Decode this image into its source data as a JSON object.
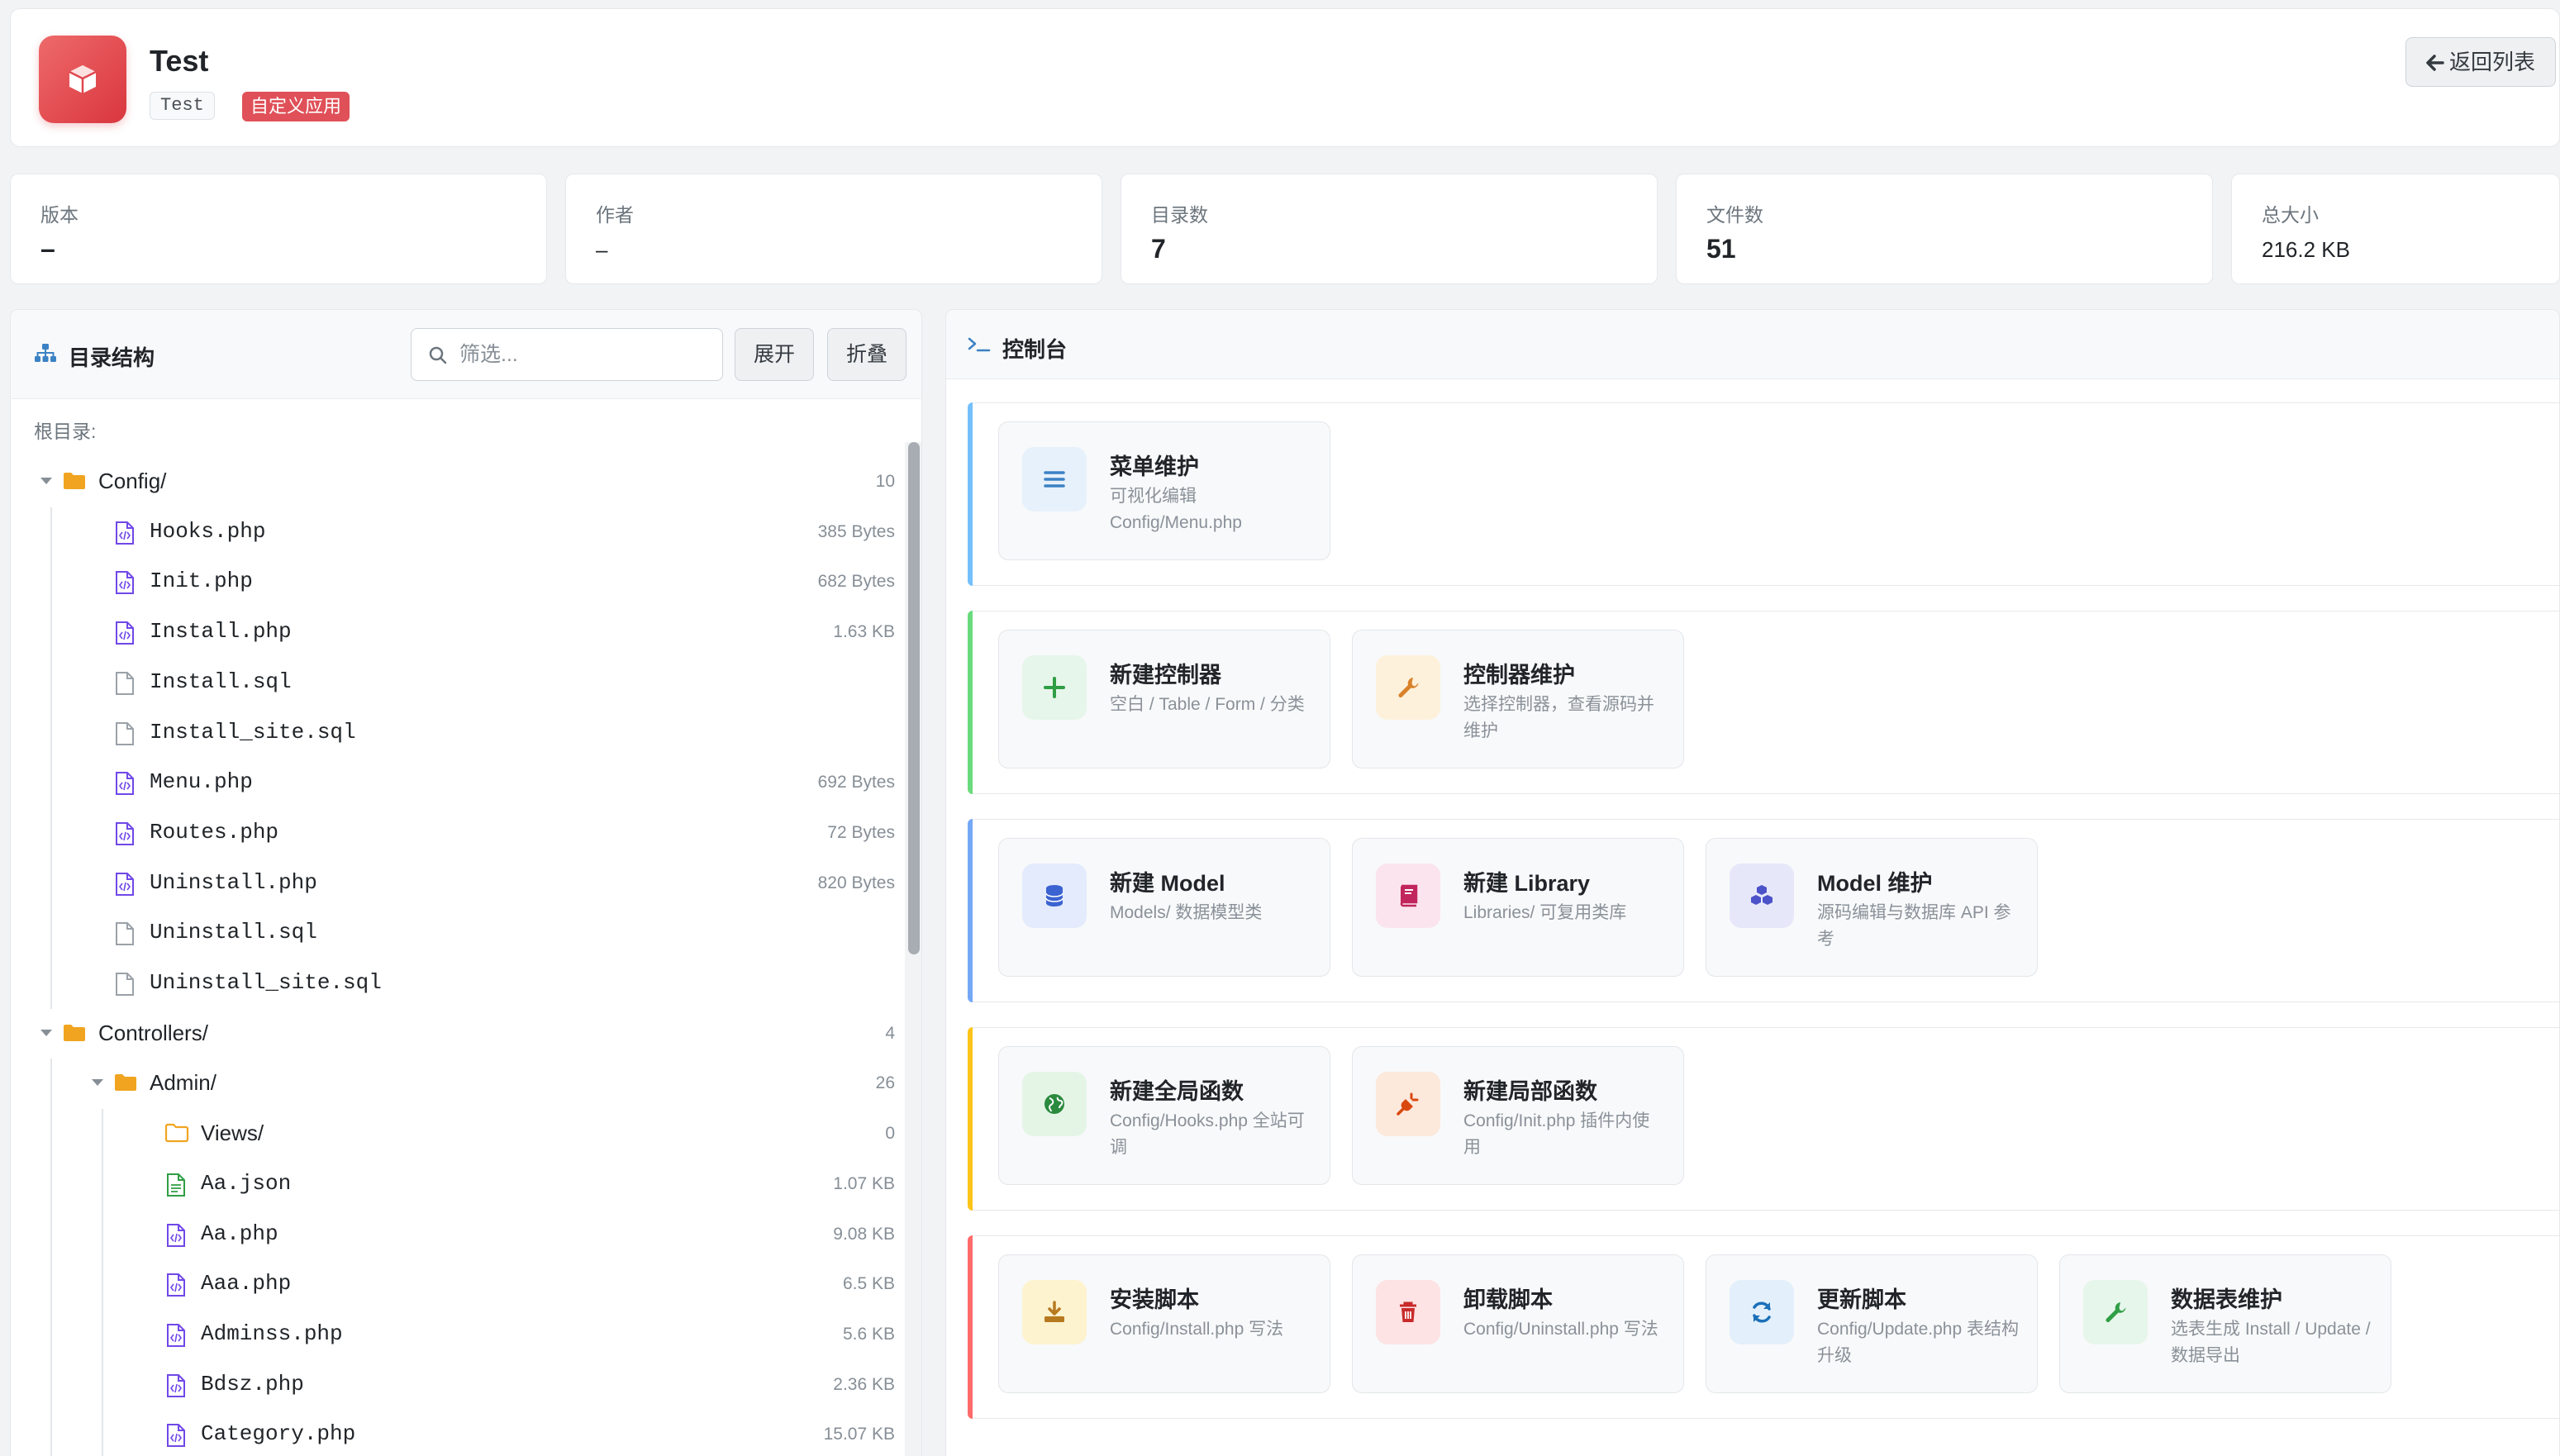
{
  "app": {
    "title": "Test",
    "code_tag": "Test",
    "type_tag": "自定义应用",
    "back_label": "返回列表",
    "icon": "cube-icon"
  },
  "stats": [
    {
      "label": "版本",
      "value": "–"
    },
    {
      "label": "作者",
      "value": "–"
    },
    {
      "label": "目录数",
      "value": "7"
    },
    {
      "label": "文件数",
      "value": "51"
    },
    {
      "label": "总大小",
      "value": "216.2 KB"
    }
  ],
  "directory": {
    "title": "目录结构",
    "filter_placeholder": "筛选...",
    "expand_label": "展开",
    "collapse_label": "折叠",
    "root_label": "根目录:",
    "rows": [
      {
        "name": "Config/",
        "meta": "10",
        "kind": "folder",
        "depth": 0,
        "open": true
      },
      {
        "name": "Hooks.php",
        "meta": "385 Bytes",
        "kind": "php",
        "depth": 1
      },
      {
        "name": "Init.php",
        "meta": "682 Bytes",
        "kind": "php",
        "depth": 1
      },
      {
        "name": "Install.php",
        "meta": "1.63 KB",
        "kind": "php",
        "depth": 1
      },
      {
        "name": "Install.sql",
        "meta": "",
        "kind": "file",
        "depth": 1
      },
      {
        "name": "Install_site.sql",
        "meta": "",
        "kind": "file",
        "depth": 1
      },
      {
        "name": "Menu.php",
        "meta": "692 Bytes",
        "kind": "php",
        "depth": 1
      },
      {
        "name": "Routes.php",
        "meta": "72 Bytes",
        "kind": "php",
        "depth": 1
      },
      {
        "name": "Uninstall.php",
        "meta": "820 Bytes",
        "kind": "php",
        "depth": 1
      },
      {
        "name": "Uninstall.sql",
        "meta": "",
        "kind": "file",
        "depth": 1
      },
      {
        "name": "Uninstall_site.sql",
        "meta": "",
        "kind": "file",
        "depth": 1
      },
      {
        "name": "Controllers/",
        "meta": "4",
        "kind": "folder",
        "depth": 0,
        "open": true
      },
      {
        "name": "Admin/",
        "meta": "26",
        "kind": "folder",
        "depth": 1,
        "open": true
      },
      {
        "name": "Views/",
        "meta": "0",
        "kind": "folder-empty",
        "depth": 2
      },
      {
        "name": "Aa.json",
        "meta": "1.07 KB",
        "kind": "json",
        "depth": 2
      },
      {
        "name": "Aa.php",
        "meta": "9.08 KB",
        "kind": "php",
        "depth": 2
      },
      {
        "name": "Aaa.php",
        "meta": "6.5 KB",
        "kind": "php",
        "depth": 2
      },
      {
        "name": "Adminss.php",
        "meta": "5.6 KB",
        "kind": "php",
        "depth": 2
      },
      {
        "name": "Bdsz.php",
        "meta": "2.36 KB",
        "kind": "php",
        "depth": 2
      },
      {
        "name": "Category.php",
        "meta": "15.07 KB",
        "kind": "php",
        "depth": 2
      }
    ]
  },
  "console": {
    "title": "控制台",
    "groups": [
      {
        "accent": "#74c0fc",
        "tiles": [
          {
            "title": "菜单维护",
            "desc": "可视化编辑 Config/Menu.php",
            "icon": "list-icon",
            "bg": "#e7f1fb",
            "fg": "#3b82c4"
          }
        ]
      },
      {
        "accent": "#69db7c",
        "tiles": [
          {
            "title": "新建控制器",
            "desc": "空白 / Table / Form / 分类",
            "icon": "plus-icon",
            "bg": "#e6f6ea",
            "fg": "#2f9e44"
          },
          {
            "title": "控制器维护",
            "desc": "选择控制器，查看源码并维护",
            "icon": "wrench-icon",
            "bg": "#fdf1dc",
            "fg": "#d9822b"
          }
        ]
      },
      {
        "accent": "#74a8f7",
        "tiles": [
          {
            "title": "新建 Model",
            "desc": "Models/ 数据模型类",
            "icon": "database-icon",
            "bg": "#e3ebfc",
            "fg": "#3b63d1"
          },
          {
            "title": "新建 Library",
            "desc": "Libraries/ 可复用类库",
            "icon": "book-icon",
            "bg": "#fbe4ee",
            "fg": "#c2255c"
          },
          {
            "title": "Model 维护",
            "desc": "源码编辑与数据库 API 参考",
            "icon": "cubes-icon",
            "bg": "#e6e8fa",
            "fg": "#4c52c8"
          }
        ]
      },
      {
        "accent": "#fcc419",
        "tiles": [
          {
            "title": "新建全局函数",
            "desc": "Config/Hooks.php 全站可调",
            "icon": "globe-icon",
            "bg": "#e4f5e6",
            "fg": "#2b8a3e"
          },
          {
            "title": "新建局部函数",
            "desc": "Config/Init.php 插件内使用",
            "icon": "plug-icon",
            "bg": "#fde8dc",
            "fg": "#d9480f"
          }
        ]
      },
      {
        "accent": "#ff6b6b",
        "tiles": [
          {
            "title": "安装脚本",
            "desc": "Config/Install.php 写法",
            "icon": "download-icon",
            "bg": "#fdf3cf",
            "fg": "#b7791f"
          },
          {
            "title": "卸载脚本",
            "desc": "Config/Uninstall.php 写法",
            "icon": "trash-icon",
            "bg": "#fde3e3",
            "fg": "#c92a2a"
          },
          {
            "title": "更新脚本",
            "desc": "Config/Update.php 表结构升级",
            "icon": "refresh-icon",
            "bg": "#e3f0fb",
            "fg": "#1c6fb8"
          },
          {
            "title": "数据表维护",
            "desc": "选表生成 Install / Update / 数据导出",
            "icon": "wrench-icon",
            "bg": "#e6f6ea",
            "fg": "#2f9e44"
          }
        ]
      }
    ]
  }
}
